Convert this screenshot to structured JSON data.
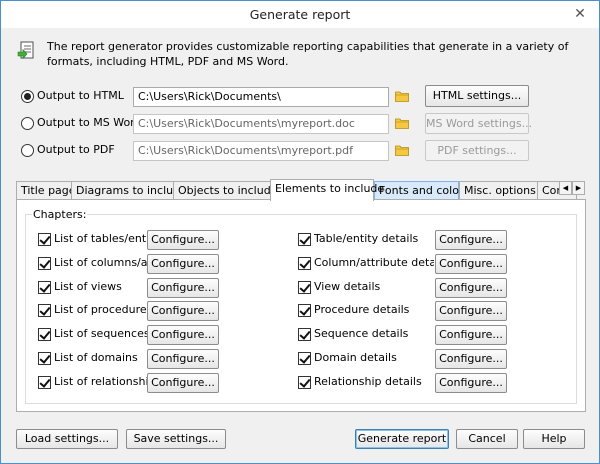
{
  "window": {
    "title": "Generate report",
    "close_glyph": "✕"
  },
  "info": {
    "text": "The report generator provides customizable reporting capabilities that generate in a variety of formats, including HTML, PDF and MS Word."
  },
  "outputs": [
    {
      "label": "Output to HTML",
      "path": "C:\\Users\\Rick\\Documents\\",
      "settings_label": "HTML settings...",
      "checked": true,
      "enabled": true
    },
    {
      "label": "Output to MS Word",
      "path": "C:\\Users\\Rick\\Documents\\myreport.doc",
      "settings_label": "MS Word settings...",
      "checked": false,
      "enabled": false
    },
    {
      "label": "Output to PDF",
      "path": "C:\\Users\\Rick\\Documents\\myreport.pdf",
      "settings_label": "PDF settings...",
      "checked": false,
      "enabled": false
    }
  ],
  "tabs": [
    {
      "label": "Title page"
    },
    {
      "label": "Diagrams to include"
    },
    {
      "label": "Objects to include"
    },
    {
      "label": "Elements to include"
    },
    {
      "label": "Fonts and colors"
    },
    {
      "label": "Misc. options"
    },
    {
      "label": "Condit"
    }
  ],
  "tab_scroll": {
    "left": "◀",
    "right": "▶"
  },
  "chapters": {
    "label": "Chapters:",
    "configure_label": "Configure...",
    "left": [
      {
        "label": "List of tables/entities",
        "checked": true
      },
      {
        "label": "List of columns/attributes",
        "checked": true
      },
      {
        "label": "List of views",
        "checked": true
      },
      {
        "label": "List of procedures",
        "checked": true
      },
      {
        "label": "List of sequences",
        "checked": true
      },
      {
        "label": "List of domains",
        "checked": true
      },
      {
        "label": "List of relationship",
        "checked": true
      }
    ],
    "right": [
      {
        "label": "Table/entity details",
        "checked": true
      },
      {
        "label": "Column/attribute details",
        "checked": true
      },
      {
        "label": "View details",
        "checked": true
      },
      {
        "label": "Procedure details",
        "checked": true
      },
      {
        "label": "Sequence details",
        "checked": true
      },
      {
        "label": "Domain details",
        "checked": true
      },
      {
        "label": "Relationship details",
        "checked": true
      }
    ]
  },
  "buttons": {
    "load": "Load settings...",
    "save": "Save settings...",
    "generate": "Generate report",
    "cancel": "Cancel",
    "help": "Help"
  }
}
